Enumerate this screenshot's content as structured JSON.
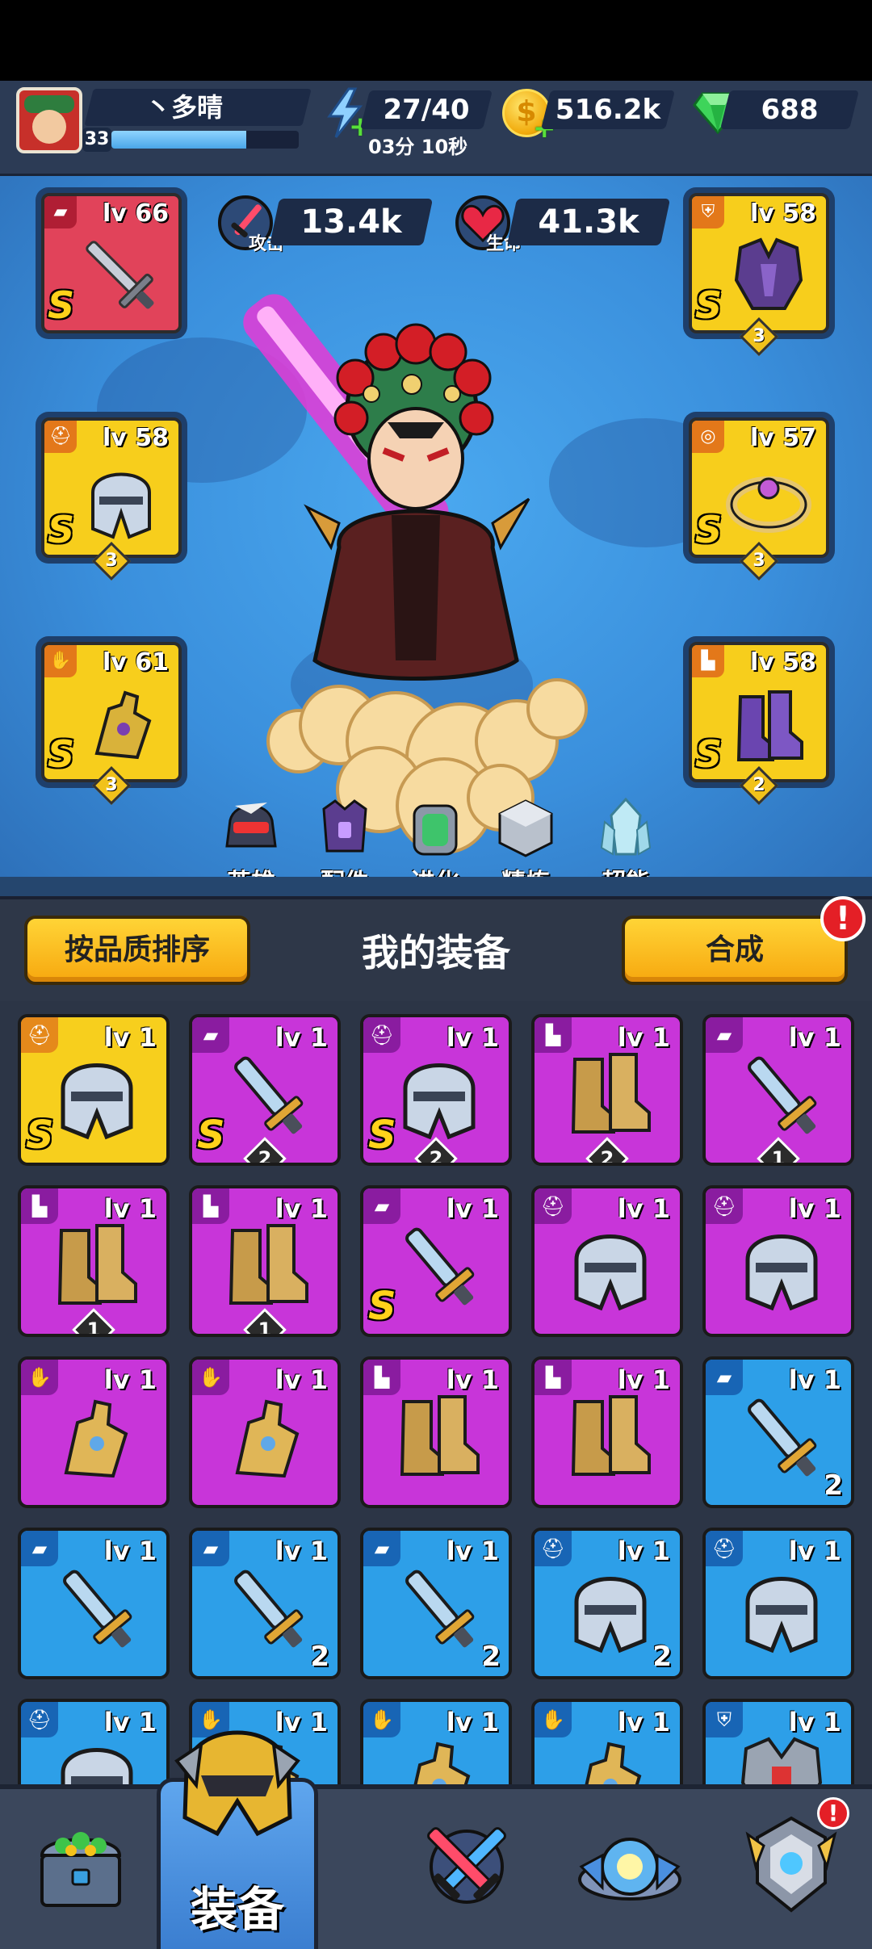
{
  "player": {
    "name": "丶多晴",
    "level": "33",
    "xp_fraction": 0.72
  },
  "resources": {
    "energy": "27/40",
    "energy_timer": "03分 10秒",
    "coins": "516.2k",
    "gems": "688"
  },
  "stats": {
    "attack_value": "13.4k",
    "attack_label": "攻击",
    "health_value": "41.3k",
    "health_label": "生命"
  },
  "equipped": [
    {
      "slot": "weapon",
      "icon": "blaster-icon",
      "level": "lv 66",
      "rank": "S",
      "stars": "",
      "rarity_color": "#e1435a"
    },
    {
      "slot": "chest",
      "icon": "armor-icon",
      "level": "lv 58",
      "rank": "S",
      "stars": "3",
      "rarity_color": "#f7ce1c"
    },
    {
      "slot": "helmet",
      "icon": "helmet-icon",
      "level": "lv 58",
      "rank": "S",
      "stars": "3",
      "rarity_color": "#f7ce1c"
    },
    {
      "slot": "belt",
      "icon": "belt-icon",
      "level": "lv 57",
      "rank": "S",
      "stars": "3",
      "rarity_color": "#f7ce1c"
    },
    {
      "slot": "gloves",
      "icon": "glove-icon",
      "level": "lv 61",
      "rank": "S",
      "stars": "3",
      "rarity_color": "#f7ce1c"
    },
    {
      "slot": "boots",
      "icon": "boot-icon",
      "level": "lv 58",
      "rank": "S",
      "stars": "2",
      "rarity_color": "#f7ce1c"
    }
  ],
  "tools": [
    {
      "label": "英雄",
      "icon": "hero-icon"
    },
    {
      "label": "配件",
      "icon": "accessory-icon"
    },
    {
      "label": "进化",
      "icon": "evolve-icon"
    },
    {
      "label": "精炼",
      "icon": "refine-icon"
    },
    {
      "label": "超能",
      "icon": "crystal-icon"
    }
  ],
  "equipment": {
    "title": "我的装备",
    "sort_button": "按品质排序",
    "merge_button": "合成",
    "merge_alert": "!"
  },
  "inventory": [
    {
      "type": "helmet",
      "rarity": "yellow",
      "level": "lv 1",
      "rank": "S",
      "count": "",
      "count_style": "none"
    },
    {
      "type": "weapon",
      "rarity": "purple",
      "level": "lv 1",
      "rank": "S",
      "count": "2",
      "count_style": "diamond"
    },
    {
      "type": "helmet",
      "rarity": "purple",
      "level": "lv 1",
      "rank": "S",
      "count": "2",
      "count_style": "diamond"
    },
    {
      "type": "boots",
      "rarity": "purple",
      "level": "lv 1",
      "rank": "",
      "count": "2",
      "count_style": "diamond"
    },
    {
      "type": "weapon",
      "rarity": "purple",
      "level": "lv 1",
      "rank": "",
      "count": "1",
      "count_style": "diamond"
    },
    {
      "type": "boots",
      "rarity": "purple",
      "level": "lv 1",
      "rank": "",
      "count": "1",
      "count_style": "diamond"
    },
    {
      "type": "boots",
      "rarity": "purple",
      "level": "lv 1",
      "rank": "",
      "count": "1",
      "count_style": "diamond"
    },
    {
      "type": "weapon",
      "rarity": "purple",
      "level": "lv 1",
      "rank": "S",
      "count": "",
      "count_style": "none"
    },
    {
      "type": "helmet",
      "rarity": "purple",
      "level": "lv 1",
      "rank": "",
      "count": "",
      "count_style": "none"
    },
    {
      "type": "helmet",
      "rarity": "purple",
      "level": "lv 1",
      "rank": "",
      "count": "",
      "count_style": "none"
    },
    {
      "type": "gloves",
      "rarity": "purple",
      "level": "lv 1",
      "rank": "",
      "count": "",
      "count_style": "none"
    },
    {
      "type": "gloves",
      "rarity": "purple",
      "level": "lv 1",
      "rank": "",
      "count": "",
      "count_style": "none"
    },
    {
      "type": "boots",
      "rarity": "purple",
      "level": "lv 1",
      "rank": "",
      "count": "",
      "count_style": "none"
    },
    {
      "type": "boots",
      "rarity": "purple",
      "level": "lv 1",
      "rank": "",
      "count": "",
      "count_style": "none"
    },
    {
      "type": "weapon",
      "rarity": "blue",
      "level": "lv 1",
      "rank": "",
      "count": "2",
      "count_style": "corner"
    },
    {
      "type": "weapon",
      "rarity": "blue",
      "level": "lv 1",
      "rank": "",
      "count": "",
      "count_style": "none"
    },
    {
      "type": "weapon",
      "rarity": "blue",
      "level": "lv 1",
      "rank": "",
      "count": "2",
      "count_style": "corner"
    },
    {
      "type": "weapon",
      "rarity": "blue",
      "level": "lv 1",
      "rank": "",
      "count": "2",
      "count_style": "corner"
    },
    {
      "type": "helmet",
      "rarity": "blue",
      "level": "lv 1",
      "rank": "",
      "count": "2",
      "count_style": "corner"
    },
    {
      "type": "helmet",
      "rarity": "blue",
      "level": "lv 1",
      "rank": "",
      "count": "",
      "count_style": "none"
    },
    {
      "type": "helmet",
      "rarity": "blue",
      "level": "lv 1",
      "rank": "",
      "count": "",
      "count_style": "none"
    },
    {
      "type": "gloves",
      "rarity": "blue",
      "level": "lv 1",
      "rank": "",
      "count": "",
      "count_style": "none"
    },
    {
      "type": "gloves",
      "rarity": "blue",
      "level": "lv 1",
      "rank": "",
      "count": "",
      "count_style": "none"
    },
    {
      "type": "gloves",
      "rarity": "blue",
      "level": "lv 1",
      "rank": "",
      "count": "",
      "count_style": "none"
    },
    {
      "type": "chest",
      "rarity": "blue",
      "level": "lv 1",
      "rank": "",
      "count": "",
      "count_style": "none"
    }
  ],
  "bottom_nav": [
    {
      "label": "",
      "icon": "treasure-chest-icon",
      "active": false,
      "alert": ""
    },
    {
      "label": "装备",
      "icon": "helmet-icon",
      "active": true,
      "alert": ""
    },
    {
      "label": "",
      "icon": "crossed-swords-icon",
      "active": false,
      "alert": ""
    },
    {
      "label": "",
      "icon": "ufo-icon",
      "active": false,
      "alert": ""
    },
    {
      "label": "",
      "icon": "rank-emblem-icon",
      "active": false,
      "alert": "!"
    }
  ],
  "colors": {
    "stage_blue": "#3a8fdc",
    "rarity_yellow": "#f7cf1d",
    "rarity_purple": "#c835d9",
    "rarity_blue": "#2d9fe8",
    "rarity_red": "#e1435a",
    "button_yellow": "#f7a80f",
    "alert_red": "#e41f26"
  }
}
